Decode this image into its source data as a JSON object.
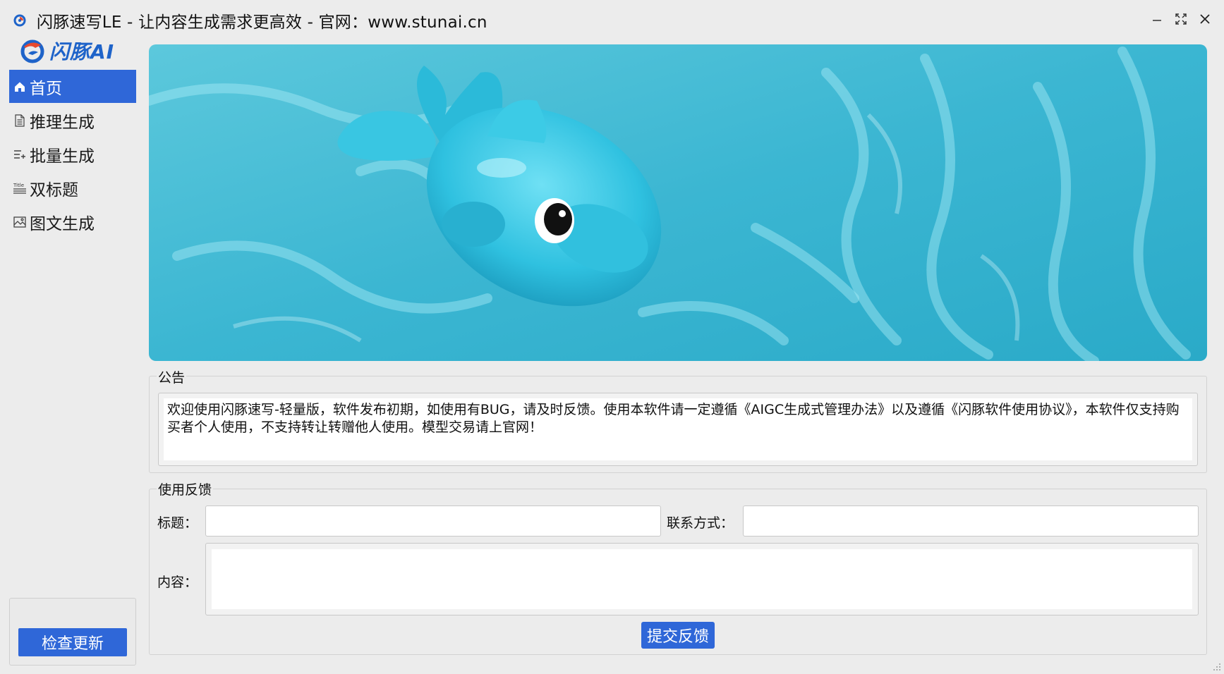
{
  "window": {
    "title": "闪豚速写LE - 让内容生成需求更高效  -  官网：www.stunai.cn"
  },
  "brand": {
    "logo_text": "闪豚AI",
    "accent_color": "#2f67d8"
  },
  "sidebar": {
    "items": [
      {
        "label": "首页",
        "icon": "home-icon",
        "active": true
      },
      {
        "label": "推理生成",
        "icon": "document-icon",
        "active": false
      },
      {
        "label": "批量生成",
        "icon": "list-add-icon",
        "active": false
      },
      {
        "label": "双标题",
        "icon": "title-icon",
        "active": false
      },
      {
        "label": "图文生成",
        "icon": "image-icon",
        "active": false
      }
    ],
    "update_button": "检查更新"
  },
  "notice": {
    "title": "公告",
    "text": "欢迎使用闪豚速写-轻量版，软件发布初期，如使用有BUG，请及时反馈。使用本软件请一定遵循《AIGC生成式管理办法》以及遵循《闪豚软件使用协议》，本软件仅支持购买者个人使用，不支持转让转赠他人使用。模型交易请上官网！"
  },
  "feedback": {
    "title": "使用反馈",
    "title_label": "标题：",
    "title_value": "",
    "contact_label": "联系方式：",
    "contact_value": "",
    "content_label": "内容：",
    "content_value": "",
    "submit_button": "提交反馈"
  }
}
